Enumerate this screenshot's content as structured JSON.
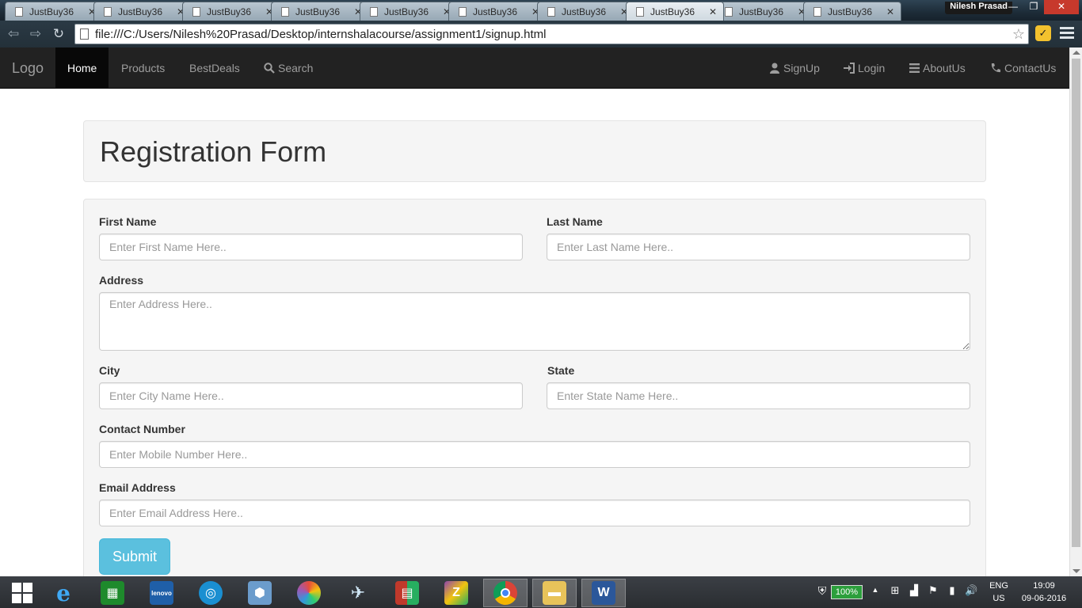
{
  "browser": {
    "tabs": [
      {
        "label": "JustBuy36",
        "active": false
      },
      {
        "label": "JustBuy36",
        "active": false
      },
      {
        "label": "JustBuy36",
        "active": false
      },
      {
        "label": "JustBuy36",
        "active": false
      },
      {
        "label": "JustBuy36",
        "active": false
      },
      {
        "label": "JustBuy36",
        "active": false
      },
      {
        "label": "JustBuy36",
        "active": false
      },
      {
        "label": "JustBuy36",
        "active": true
      },
      {
        "label": "JustBuy36",
        "active": false
      },
      {
        "label": "JustBuy36",
        "active": false
      }
    ],
    "user_name": "Nilesh Prasad",
    "url": "file:///C:/Users/Nilesh%20Prasad/Desktop/internshalacourse/assignment1/signup.html"
  },
  "navbar": {
    "brand": "Logo",
    "left_items": [
      {
        "label": "Home",
        "active": true
      },
      {
        "label": "Products",
        "active": false
      },
      {
        "label": "BestDeals",
        "active": false
      },
      {
        "label": "Search",
        "icon": "search-icon"
      }
    ],
    "right_items": [
      {
        "label": "SignUp",
        "icon": "user-icon"
      },
      {
        "label": "Login",
        "icon": "login-icon"
      },
      {
        "label": "AboutUs",
        "icon": "list-icon"
      },
      {
        "label": "ContactUs",
        "icon": "phone-icon"
      }
    ]
  },
  "form": {
    "title": "Registration Form",
    "first_name": {
      "label": "First Name",
      "placeholder": "Enter First Name Here.."
    },
    "last_name": {
      "label": "Last Name",
      "placeholder": "Enter Last Name Here.."
    },
    "address": {
      "label": "Address",
      "placeholder": "Enter Address Here.."
    },
    "city": {
      "label": "City",
      "placeholder": "Enter City Name Here.."
    },
    "state": {
      "label": "State",
      "placeholder": "Enter State Name Here.."
    },
    "contact": {
      "label": "Contact Number",
      "placeholder": "Enter Mobile Number Here.."
    },
    "email": {
      "label": "Email Address",
      "placeholder": "Enter Email Address Here.."
    },
    "submit_label": "Submit"
  },
  "taskbar": {
    "battery": "100%",
    "language": "ENG",
    "region": "US",
    "time": "19:09",
    "date": "09-06-2016"
  },
  "colors": {
    "navbar_bg": "#222222",
    "submit_bg": "#5bc0de",
    "well_bg": "#f5f5f5"
  }
}
